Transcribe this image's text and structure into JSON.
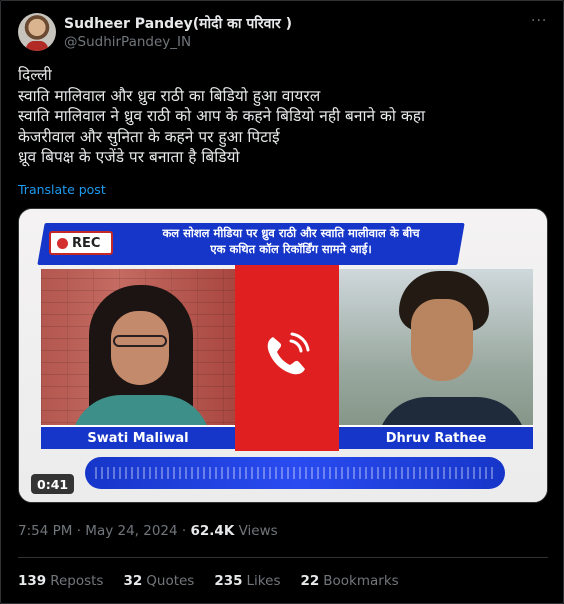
{
  "author": {
    "name": "Sudheer Pandey(मोदी का परिवार )",
    "handle": "@SudhirPandey_IN"
  },
  "more_label": "···",
  "body": [
    "दिल्ली",
    "स्वाति मालिवाल और ध्रुव राठी का बिडियो हुआ वायरल",
    "स्वाति मालिवाल ने ध्रुव राठी को आप के कहने बिडियो नही बनाने को कहा",
    "केजरीवाल और सुनिता के कहने पर हुआ पिटाई",
    "ध्रूव बिपक्ष के एजेंडे पर बनाता है बिडियो"
  ],
  "translate_label": "Translate post",
  "media": {
    "rec_label": "REC",
    "banner_line1": "कल सोशल मीडिया पर ध्रुव राठी और स्वाति मालीवाल के बीच",
    "banner_line2": "एक कथित कॉल रिकॉर्डिंग सामने आई।",
    "left_name": "Swati Maliwal",
    "right_name": "Dhruv Rathee",
    "duration": "0:41"
  },
  "meta": {
    "time": "7:54 PM",
    "separator": "·",
    "date": "May 24, 2024",
    "views_count": "62.4K",
    "views_label": "Views"
  },
  "stats": {
    "reposts_count": "139",
    "reposts_label": "Reposts",
    "quotes_count": "32",
    "quotes_label": "Quotes",
    "likes_count": "235",
    "likes_label": "Likes",
    "bookmarks_count": "22",
    "bookmarks_label": "Bookmarks"
  },
  "colors": {
    "accent": "#1d9bf0",
    "banner_blue": "#1636c9",
    "call_red": "#e02020"
  }
}
